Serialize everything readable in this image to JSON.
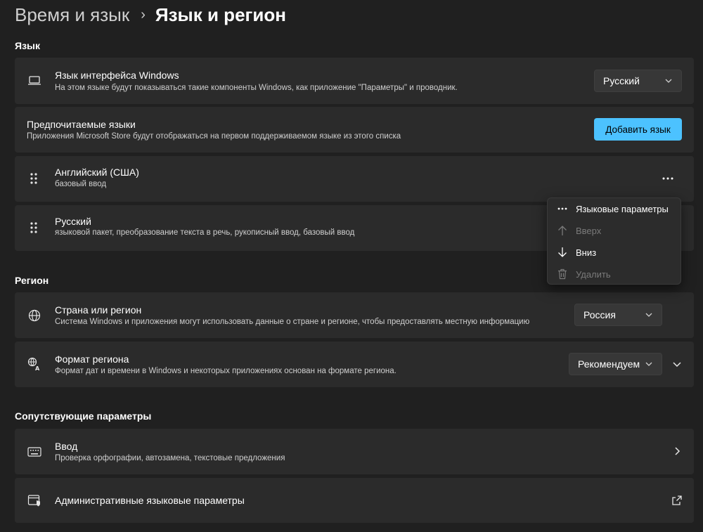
{
  "breadcrumb": {
    "parent": "Время и язык",
    "separator": "›",
    "current": "Язык и регион"
  },
  "sections": {
    "language": "Язык",
    "region": "Регион",
    "related": "Сопутствующие параметры"
  },
  "display_language": {
    "title": "Язык интерфейса Windows",
    "subtitle": "На этом языке будут показываться такие компоненты Windows, как приложение \"Параметры\" и проводник.",
    "value": "Русский",
    "icon": "laptop-icon"
  },
  "preferred_languages": {
    "title": "Предпочитаемые языки",
    "subtitle": "Приложения Microsoft Store будут отображаться на первом поддерживаемом языке из этого списка",
    "add_button": "Добавить язык"
  },
  "languages": [
    {
      "title": "Английский (США)",
      "subtitle": "базовый ввод"
    },
    {
      "title": "Русский",
      "subtitle": "языковой пакет, преобразование текста в речь, рукописный ввод, базовый ввод"
    }
  ],
  "context_menu": {
    "items": [
      {
        "label": "Языковые параметры",
        "icon": "more-icon",
        "enabled": true
      },
      {
        "label": "Вверх",
        "icon": "arrow-up-icon",
        "enabled": false
      },
      {
        "label": "Вниз",
        "icon": "arrow-down-icon",
        "enabled": true
      },
      {
        "label": "Удалить",
        "icon": "trash-icon",
        "enabled": false
      }
    ]
  },
  "country": {
    "title": "Страна или регион",
    "subtitle": "Система Windows и приложения могут использовать данные о стране и регионе, чтобы предоставлять местную информацию",
    "value": "Россия",
    "icon": "globe-icon"
  },
  "regional_format": {
    "title": "Формат региона",
    "subtitle": "Формат дат и времени в Windows и некоторых приложениях основан на формате региона.",
    "value": "Рекомендуем",
    "icon": "regional-format-icon"
  },
  "typing": {
    "title": "Ввод",
    "subtitle": "Проверка орфографии, автозамена, текстовые предложения",
    "icon": "keyboard-icon"
  },
  "admin_language": {
    "title": "Административные языковые параметры",
    "icon": "admin-shield-icon"
  },
  "colors": {
    "background": "#202020",
    "card": "#2b2b2b",
    "accent": "#4cc2ff",
    "text": "#ffffff",
    "subtext": "#cfcfcf",
    "disabled": "#7a7a7a"
  }
}
